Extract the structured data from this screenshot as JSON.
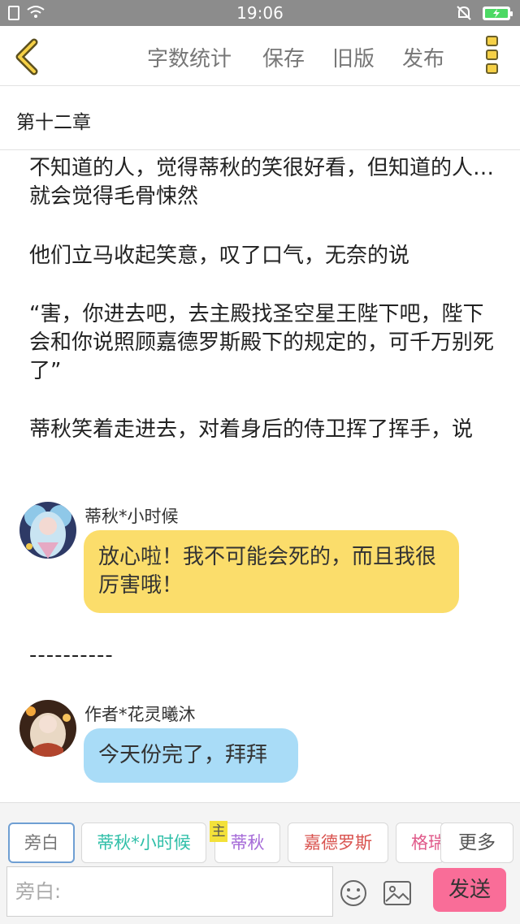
{
  "status_bar": {
    "time": "19:06"
  },
  "nav": {
    "actions": [
      "字数统计",
      "保存",
      "旧版",
      "发布"
    ]
  },
  "chapter": {
    "title": "第十二章"
  },
  "content": {
    "paragraphs": [
      "不知道的人，觉得蒂秋的笑很好看，但知道的人…就会觉得毛骨悚然",
      "他们立马收起笑意，叹了口气，无奈的说",
      "“害，你进去吧，去主殿找圣空星王陛下吧，陛下会和你说照顾嘉德罗斯殿下的规定的，可千万别死了”",
      "蒂秋笑着走进去，对着身后的侍卫挥了挥手，说"
    ],
    "messages": [
      {
        "speaker": "蒂秋*小时候",
        "text": "放心啦！我不可能会死的，而且我很厉害哦！"
      },
      {
        "speaker": "作者*花灵曦沐",
        "text": "今天份完了，拜拜"
      }
    ],
    "divider": "----------"
  },
  "role_bar": {
    "roles": [
      {
        "label": "旁白",
        "color": "#777777"
      },
      {
        "label": "蒂秋*小时候",
        "color": "#2fbfa8"
      },
      {
        "label": "蒂秋",
        "color": "#a56ad8"
      },
      {
        "label": "嘉德罗斯",
        "color": "#d9534f"
      },
      {
        "label": "格瑞",
        "color": "#e05a8a"
      }
    ],
    "main_tag": "主",
    "more_label": "更多",
    "input_placeholder": "旁白:",
    "send_label": "发送"
  },
  "icons": {
    "back": "chevron-left-icon",
    "menu": "vertical-menu-icon",
    "emoji": "smiley-icon",
    "image": "image-icon"
  },
  "colors": {
    "accent_yellow": "#f5d046",
    "bubble_yellow": "#fbdd6b",
    "bubble_blue": "#a9dcf7",
    "send_pink": "#f96d98"
  }
}
